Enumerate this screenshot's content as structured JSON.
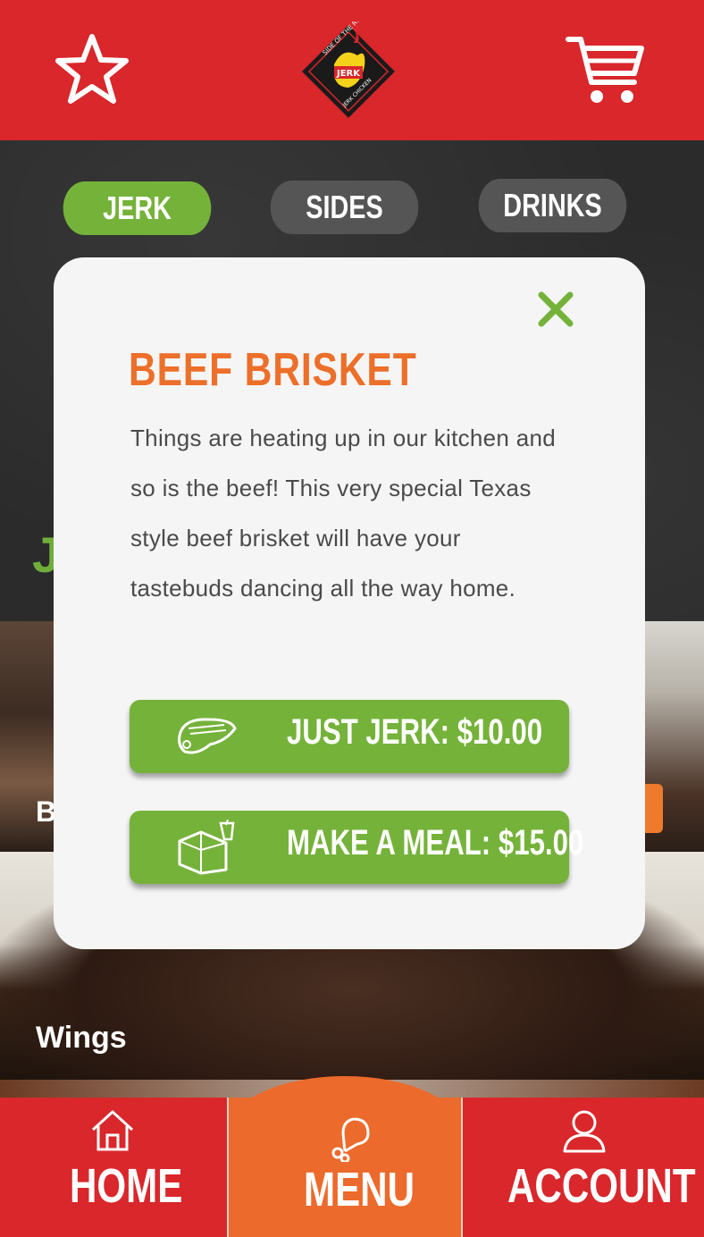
{
  "header": {
    "favorite_icon": "star-icon",
    "cart_icon": "cart-icon",
    "logo": {
      "top_text": "SIDE OF THE ROAD",
      "center_text": "JERK",
      "bottom_text": "JERK CHICKEN"
    }
  },
  "tabs": [
    {
      "label": "JERK",
      "active": true
    },
    {
      "label": "SIDES",
      "active": false
    },
    {
      "label": "DRINKS",
      "active": false
    }
  ],
  "menu_items": [
    {
      "label": "B"
    },
    {
      "label": "Wings"
    }
  ],
  "modal": {
    "title": "BEEF BRISKET",
    "description": "Things are heating up in our kitchen and so is the beef! This very special Texas style beef brisket will have your tastebuds dancing all the way home.",
    "options": [
      {
        "label": "JUST JERK: $10.00",
        "icon": "chicken-wing-icon"
      },
      {
        "label": "MAKE A MEAL: $15.00",
        "icon": "meal-box-icon"
      }
    ],
    "close_icon": "close-icon"
  },
  "bottom_nav": [
    {
      "label": "HOME",
      "icon": "home-icon",
      "active": false
    },
    {
      "label": "MENU",
      "icon": "drumstick-icon",
      "active": true
    },
    {
      "label": "ACCOUNT",
      "icon": "user-icon",
      "active": false
    }
  ],
  "colors": {
    "brand_red": "#d9272b",
    "accent_orange": "#ec6a2b",
    "accent_green": "#75b23a",
    "tab_inactive": "#555555"
  }
}
